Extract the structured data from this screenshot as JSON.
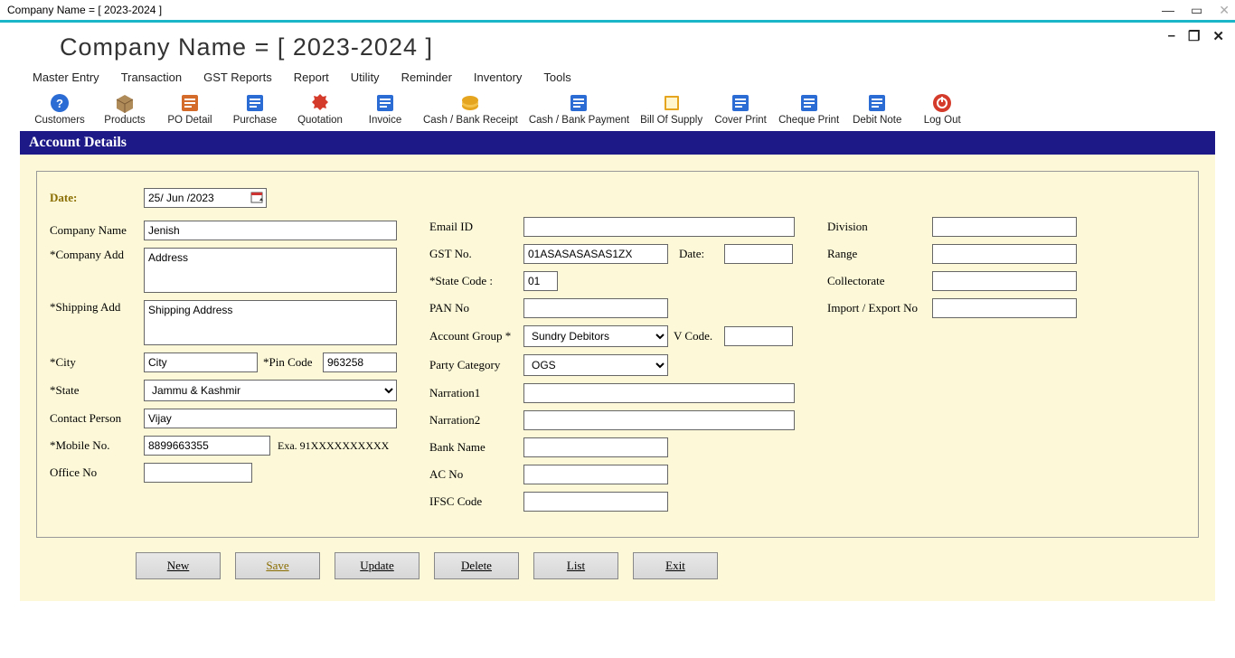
{
  "outer_title": "Company Name    =    [   2023-2024   ]",
  "big_title": "Company Name     =     [    2023-2024    ]",
  "menu": [
    "Master Entry",
    "Transaction",
    "GST Reports",
    "Report",
    "Utility",
    "Reminder",
    "Inventory",
    "Tools"
  ],
  "ribbon": [
    {
      "label": "Customers",
      "icon": "q"
    },
    {
      "label": "Products",
      "icon": "box"
    },
    {
      "label": "PO Detail",
      "icon": "clip"
    },
    {
      "label": "Purchase",
      "icon": "cart"
    },
    {
      "label": "Quotation",
      "icon": "sale"
    },
    {
      "label": "Invoice",
      "icon": "doc"
    },
    {
      "label": "Cash / Bank Receipt",
      "icon": "coin"
    },
    {
      "label": "Cash / Bank Payment",
      "icon": "money"
    },
    {
      "label": "Bill Of Supply",
      "icon": "book"
    },
    {
      "label": "Cover Print",
      "icon": "print"
    },
    {
      "label": "Cheque Print",
      "icon": "cheque"
    },
    {
      "label": "Debit Note",
      "icon": "debit"
    },
    {
      "label": "Log Out",
      "icon": "off"
    }
  ],
  "section_title": "Account Details",
  "labels": {
    "date": "Date:",
    "company_name": "Company Name",
    "company_add": "*Company Add",
    "shipping_add": "*Shipping Add",
    "city": "*City",
    "pin": "*Pin Code",
    "state": "*State",
    "contact": "Contact Person",
    "mobile": "*Mobile No.",
    "mobile_hint": "Exa. 91XXXXXXXXXX",
    "office": "Office No",
    "email": "Email ID",
    "gst": "GST No.",
    "gst_date": "Date:",
    "state_code": "*State Code :",
    "pan": "PAN No",
    "acct_group": "Account Group *",
    "vcode": "V Code.",
    "party": "Party Category",
    "narr1": "Narration1",
    "narr2": "Narration2",
    "bank": "Bank Name",
    "ac_no": "AC No",
    "ifsc": "IFSC Code",
    "division": "Division",
    "range": "Range",
    "collect": "Collectorate",
    "impexp": "Import / Export No"
  },
  "values": {
    "date": "25/ Jun /2023",
    "company_name": "Jenish",
    "company_add": "Address",
    "shipping_add": "Shipping Address",
    "city": "City",
    "pin": "963258",
    "state": "Jammu & Kashmir",
    "contact": "Vijay",
    "mobile": "8899663355",
    "office": "",
    "email": "",
    "gst": "01ASASASASAS1ZX",
    "gst_date": "",
    "state_code": "01",
    "pan": "",
    "acct_group": "Sundry Debitors",
    "vcode": "",
    "party": "OGS",
    "narr1": "",
    "narr2": "",
    "bank": "",
    "ac_no": "",
    "ifsc": "",
    "division": "",
    "range": "",
    "collect": "",
    "impexp": ""
  },
  "buttons": [
    "New",
    "Save",
    "Update",
    "Delete",
    "List",
    "Exit"
  ]
}
